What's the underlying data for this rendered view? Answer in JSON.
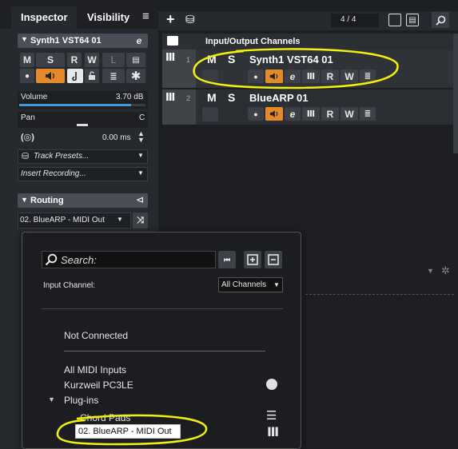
{
  "inspector": {
    "tab_inspector": "Inspector",
    "tab_visibility": "Visibility",
    "track_name": "Synth1 VST64 01",
    "btn_m": "M",
    "btn_s": "S",
    "btn_r": "R",
    "btn_w": "W",
    "btn_l": "L",
    "volume_label": "Volume",
    "volume_value": "3.70 dB",
    "pan_label": "Pan",
    "pan_value": "C",
    "delay_value": "0.00 ms",
    "track_presets": "Track Presets...",
    "insert_recording": "Insert Recording...",
    "routing_label": "Routing",
    "routing_input": "02. BlueARP - MIDI Out"
  },
  "toolbar": {
    "counter": "4 / 4"
  },
  "tracklist": {
    "folder_title": "Input/Output Channels",
    "tracks": [
      {
        "number": "1",
        "name": "Synth1 VST64 01",
        "m": "M",
        "s": "S",
        "r": "R",
        "w": "W"
      },
      {
        "number": "2",
        "name": "BlueARP 01",
        "m": "M",
        "s": "S",
        "r": "R",
        "w": "W"
      }
    ]
  },
  "popup": {
    "search_placeholder": "Search:",
    "input_channel_label": "Input Channel:",
    "filter_value": "All Channels",
    "items": {
      "not_connected": "Not Connected",
      "all_midi_inputs": "All MIDI Inputs",
      "kurzweil": "Kurzweil PC3LE",
      "plugins": "Plug-ins",
      "chord_pads": "Chord Pads",
      "bluearp": "02. BlueARP - MIDI Out"
    }
  },
  "colors": {
    "panel": "#26292d",
    "header": "#3c4046",
    "accent_blue": "#3d9be0",
    "orange": "#e58a2b",
    "highlight_yellow": "#f1f20a"
  }
}
